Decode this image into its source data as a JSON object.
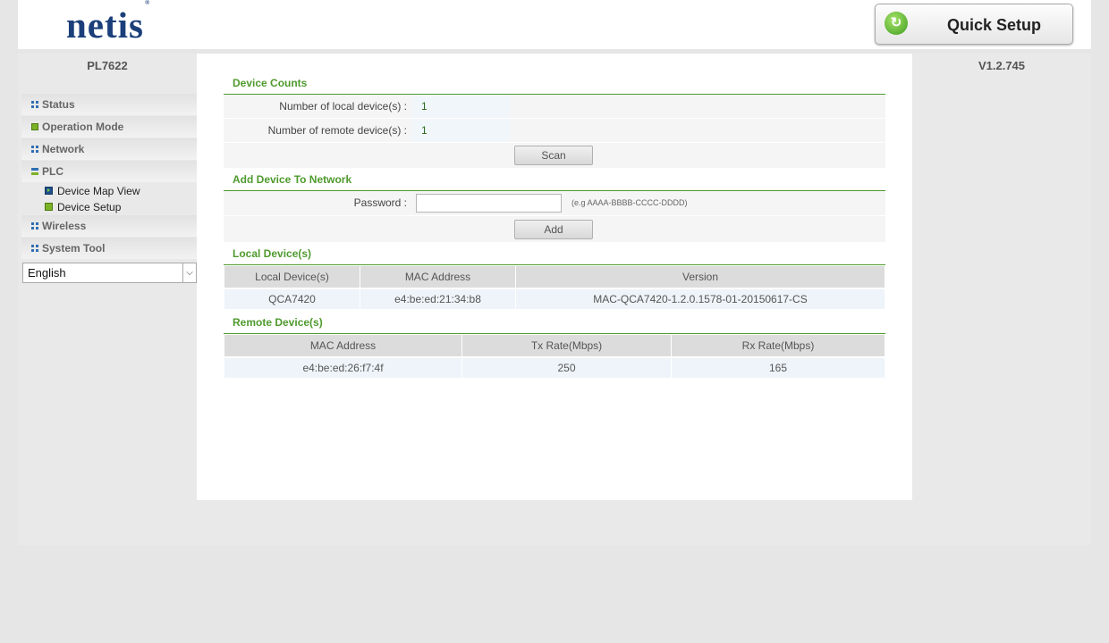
{
  "header": {
    "logo": "netis",
    "logo_mark": "®",
    "quick_setup_label": "Quick Setup"
  },
  "sidebar": {
    "model": "PL7622",
    "items": [
      {
        "label": "Status",
        "icon": "grid-icon"
      },
      {
        "label": "Operation Mode",
        "icon": "green-square-icon"
      },
      {
        "label": "Network",
        "icon": "grid-icon"
      },
      {
        "label": "PLC",
        "icon": "bars-icon"
      },
      {
        "label": "Wireless",
        "icon": "grid-icon"
      },
      {
        "label": "System Tool",
        "icon": "grid-icon"
      }
    ],
    "plc_subitems": [
      {
        "label": "Device Map View",
        "icon": "play-icon"
      },
      {
        "label": "Device Setup",
        "icon": "green-square-icon"
      }
    ],
    "language": "English"
  },
  "version": "V1.2.745",
  "device_counts": {
    "title": "Device Counts",
    "local_label": "Number of local device(s) :",
    "local_value": "1",
    "remote_label": "Number of remote device(s) :",
    "remote_value": "1",
    "scan_label": "Scan"
  },
  "add_device": {
    "title": "Add Device To Network",
    "password_label": "Password :",
    "password_value": "",
    "hint": "(e.g AAAA-BBBB-CCCC-DDDD)",
    "add_label": "Add"
  },
  "local_devices": {
    "title": "Local Device(s)",
    "headers": [
      "Local Device(s)",
      "MAC Address",
      "Version"
    ],
    "rows": [
      [
        "QCA7420",
        "e4:be:ed:21:34:b8",
        "MAC-QCA7420-1.2.0.1578-01-20150617-CS"
      ]
    ]
  },
  "remote_devices": {
    "title": "Remote Device(s)",
    "headers": [
      "MAC Address",
      "Tx Rate(Mbps)",
      "Rx Rate(Mbps)"
    ],
    "rows": [
      [
        "e4:be:ed:26:f7:4f",
        "250",
        "165"
      ]
    ]
  },
  "colors": {
    "accent_green": "#4f9a2e",
    "logo_blue": "#1b3f7a",
    "menu_icon_blue": "#2f6fb3"
  }
}
